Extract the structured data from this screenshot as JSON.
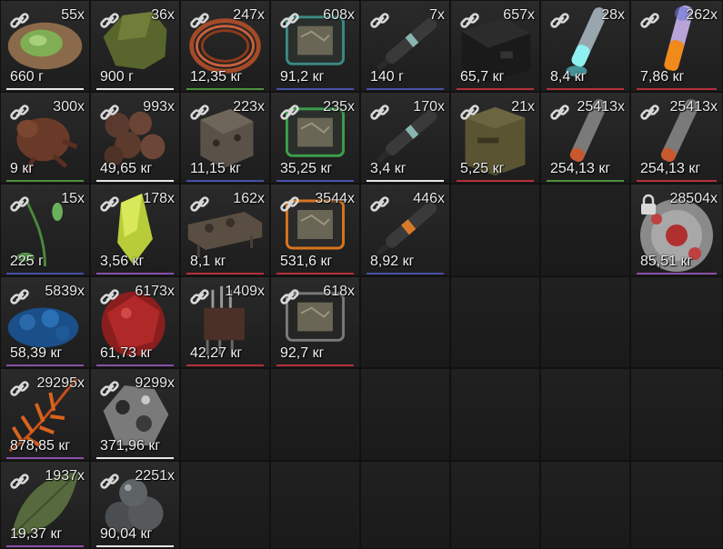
{
  "inventory": {
    "rarity_colors": {
      "white": "#e6e6e6",
      "green": "#4c8f3e",
      "blue": "#4650a8",
      "purple": "#8a4fa8",
      "red": "#b3303a"
    },
    "rows": [
      [
        {
          "count": "55x",
          "weight": "660 г",
          "icon": "green-blob-icon",
          "rarity": "white",
          "locked": false
        },
        {
          "count": "36x",
          "weight": "900 г",
          "icon": "green-rock-icon",
          "rarity": "white",
          "locked": false
        },
        {
          "count": "247x",
          "weight": "12,35 кг",
          "icon": "copper-coil-icon",
          "rarity": "green",
          "locked": false
        },
        {
          "count": "608x",
          "weight": "91,2 кг",
          "icon": "teal-tablet-icon",
          "rarity": "blue",
          "locked": false
        },
        {
          "count": "7x",
          "weight": "140 г",
          "icon": "syringe-icon",
          "rarity": "blue",
          "locked": false
        },
        {
          "count": "657x",
          "weight": "65,7 кг",
          "icon": "black-box-icon",
          "rarity": "red",
          "locked": false
        },
        {
          "count": "28x",
          "weight": "8,4 кг",
          "icon": "glowing-stick-icon",
          "rarity": "red",
          "locked": false
        },
        {
          "count": "262x",
          "weight": "7,86 кг",
          "icon": "orange-stick-icon",
          "rarity": "red",
          "locked": false
        }
      ],
      [
        {
          "count": "300x",
          "weight": "9 кг",
          "icon": "brown-creature-icon",
          "rarity": "green",
          "locked": false
        },
        {
          "count": "993x",
          "weight": "49,65 кг",
          "icon": "brown-spheres-icon",
          "rarity": "white",
          "locked": false
        },
        {
          "count": "223x",
          "weight": "11,15 кг",
          "icon": "metal-cube-icon",
          "rarity": "blue",
          "locked": false
        },
        {
          "count": "235x",
          "weight": "35,25 кг",
          "icon": "green-tablet-icon",
          "rarity": "blue",
          "locked": false
        },
        {
          "count": "170x",
          "weight": "3,4 кг",
          "icon": "syringe-icon",
          "rarity": "white",
          "locked": false
        },
        {
          "count": "21x",
          "weight": "5,25 кг",
          "icon": "ammo-box-icon",
          "rarity": "red",
          "locked": false
        },
        {
          "count": "25413x",
          "weight": "254,13 кг",
          "icon": "gray-stick-icon",
          "rarity": "green",
          "locked": false
        },
        {
          "count": "25413x",
          "weight": "254,13 кг",
          "icon": "gray-stick-icon",
          "rarity": "red",
          "locked": false
        }
      ],
      [
        {
          "count": "15x",
          "weight": "225 г",
          "icon": "green-sprout-icon",
          "rarity": "blue",
          "locked": false
        },
        {
          "count": "178x",
          "weight": "3,56 кг",
          "icon": "yellow-crystal-icon",
          "rarity": "purple",
          "locked": false
        },
        {
          "count": "162x",
          "weight": "8,1 кг",
          "icon": "metal-plate-icon",
          "rarity": "red",
          "locked": false
        },
        {
          "count": "3544x",
          "weight": "531,6 кг",
          "icon": "orange-tablet-icon",
          "rarity": "red",
          "locked": false
        },
        {
          "count": "446x",
          "weight": "8,92 кг",
          "icon": "orange-syringe-icon",
          "rarity": "blue",
          "locked": false
        },
        null,
        null,
        {
          "count": "28504x",
          "weight": "85,51 кг",
          "icon": "red-disc-icon",
          "rarity": "purple",
          "locked": true
        }
      ],
      [
        {
          "count": "5839x",
          "weight": "58,39 кг",
          "icon": "blue-moss-icon",
          "rarity": "purple",
          "locked": false
        },
        {
          "count": "6173x",
          "weight": "61,73 кг",
          "icon": "red-orb-icon",
          "rarity": "purple",
          "locked": false
        },
        {
          "count": "1409x",
          "weight": "42,27 кг",
          "icon": "circuit-chip-icon",
          "rarity": "red",
          "locked": false
        },
        {
          "count": "618x",
          "weight": "92,7 кг",
          "icon": "gray-tablet-icon",
          "rarity": "red",
          "locked": false
        },
        null,
        null,
        null,
        null
      ],
      [
        {
          "count": "29295x",
          "weight": "878,85 кг",
          "icon": "orange-fern-icon",
          "rarity": "purple",
          "locked": false
        },
        {
          "count": "9299x",
          "weight": "371,96 кг",
          "icon": "gray-ore-icon",
          "rarity": "white",
          "locked": false
        },
        null,
        null,
        null,
        null,
        null,
        null
      ],
      [
        {
          "count": "1937x",
          "weight": "19,37 кг",
          "icon": "leaf-icon",
          "rarity": "purple",
          "locked": false
        },
        {
          "count": "2251x",
          "weight": "90,04 кг",
          "icon": "dark-spheres-icon",
          "rarity": "white",
          "locked": false
        },
        null,
        null,
        null,
        null,
        null,
        null
      ]
    ]
  }
}
